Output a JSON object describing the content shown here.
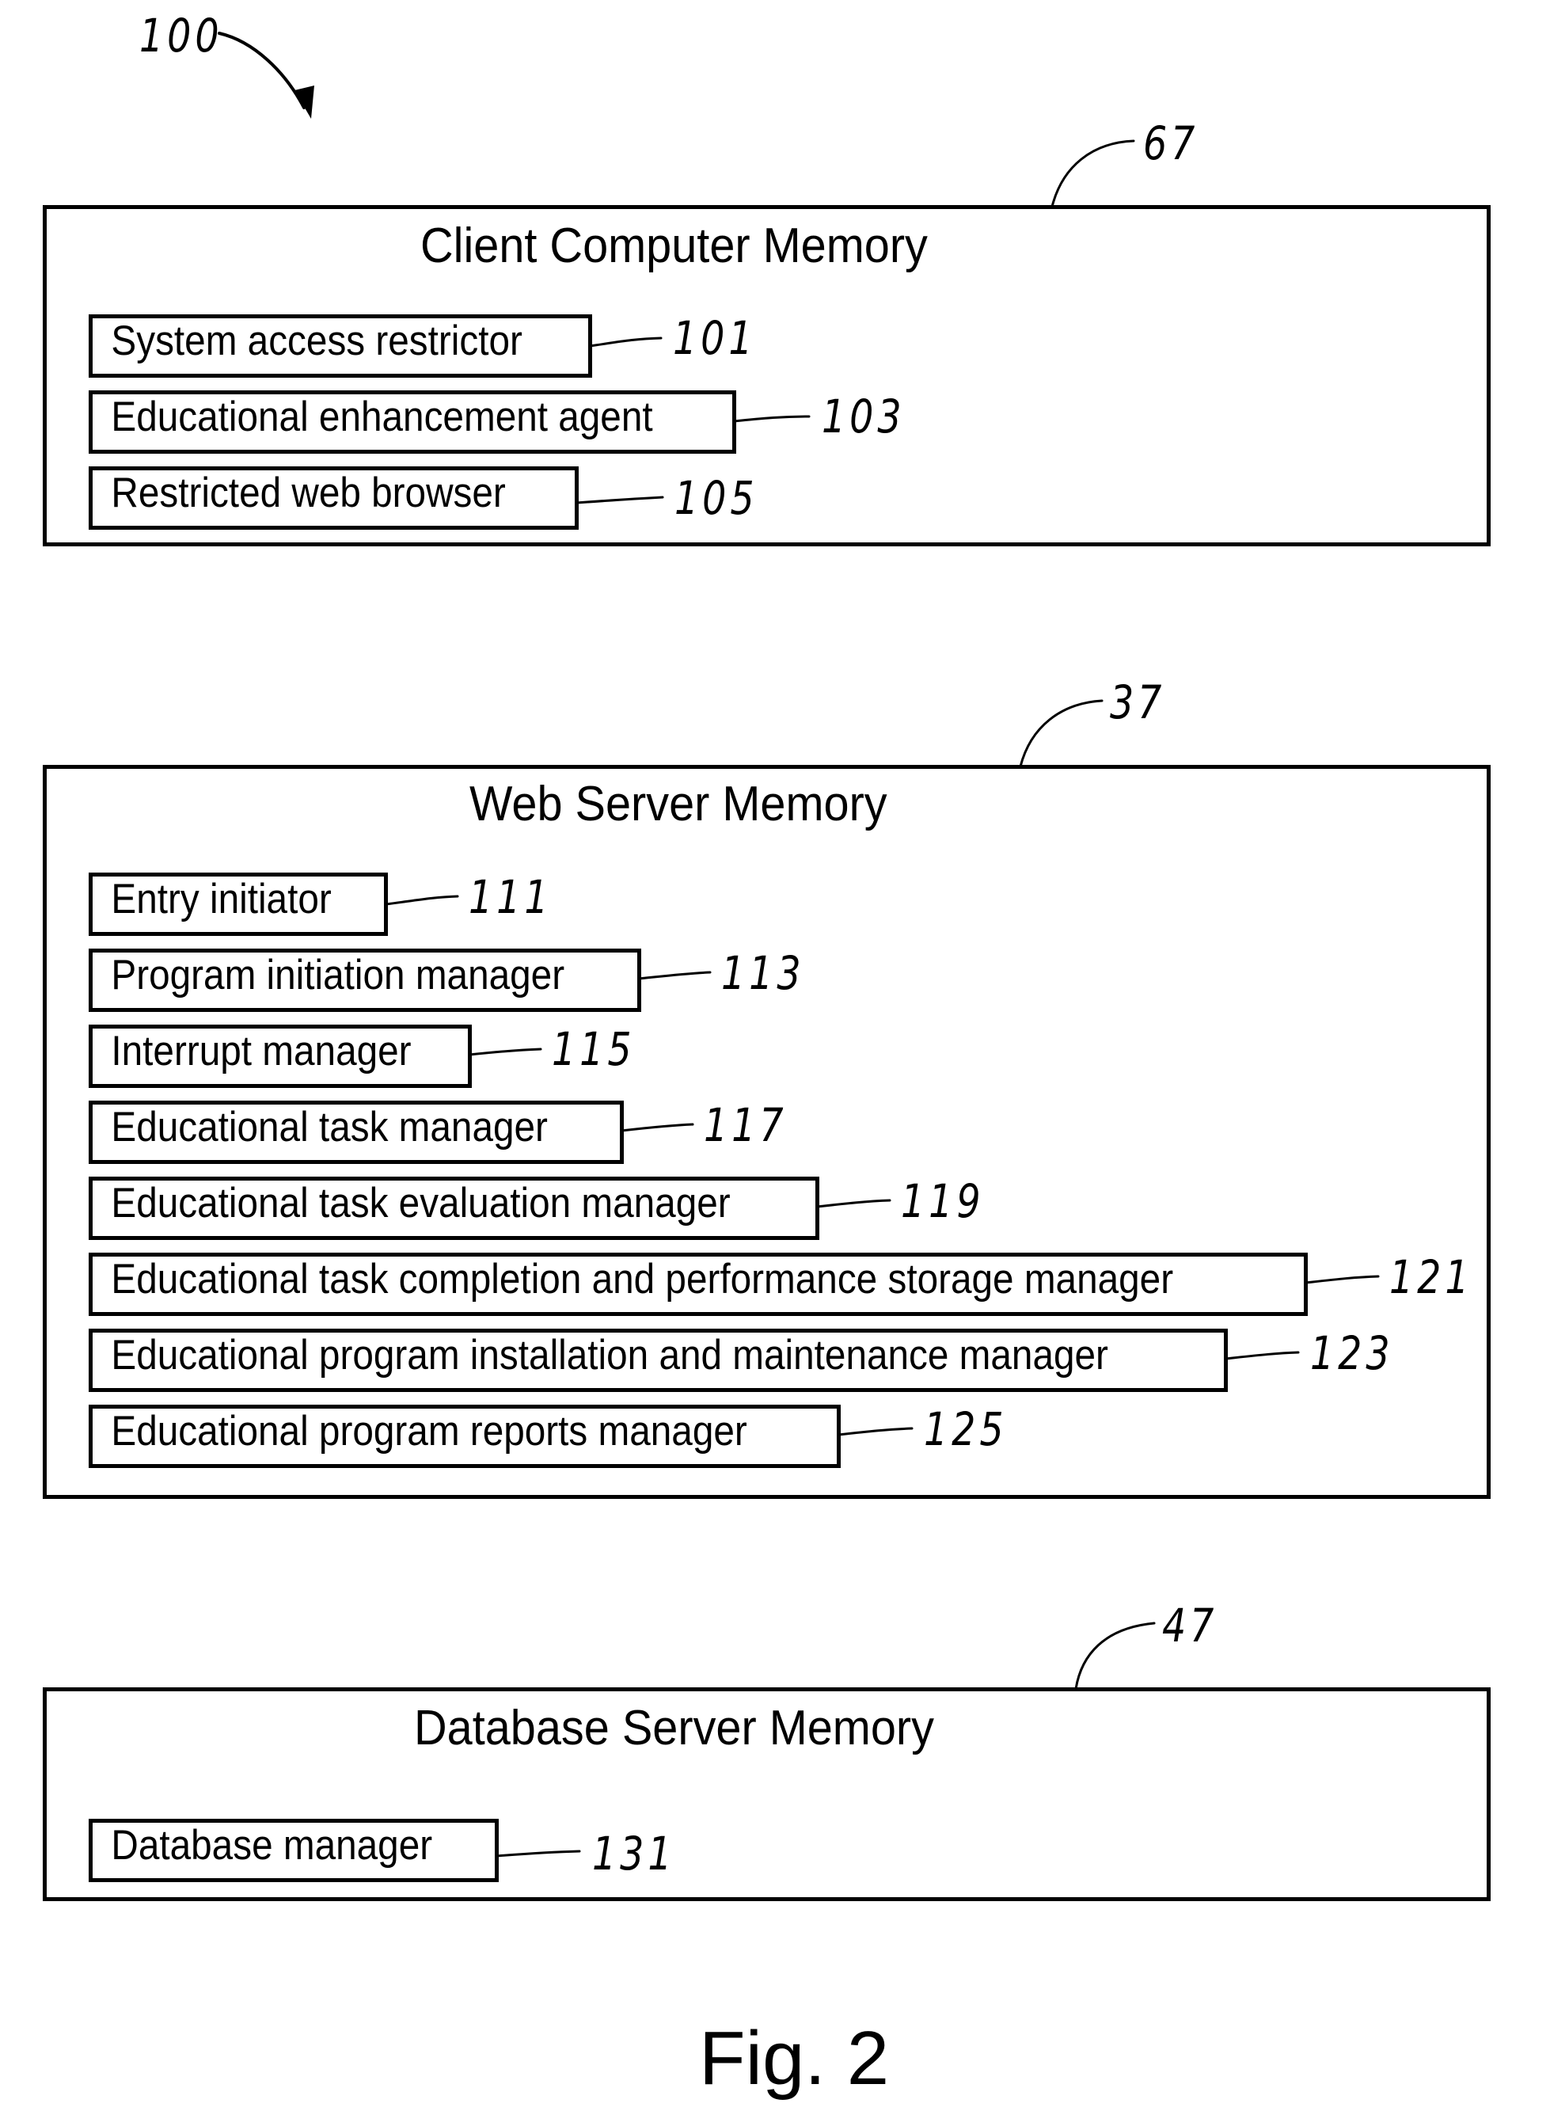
{
  "figure": {
    "reference": "100",
    "caption": "Fig. 2"
  },
  "blocks": [
    {
      "id": "client",
      "title": "Client Computer Memory",
      "reference": "67",
      "items": [
        {
          "label": "System access restrictor",
          "reference": "101"
        },
        {
          "label": "Educational enhancement agent",
          "reference": "103"
        },
        {
          "label": "Restricted web browser",
          "reference": "105"
        }
      ]
    },
    {
      "id": "web",
      "title": "Web Server Memory",
      "reference": "37",
      "items": [
        {
          "label": "Entry initiator",
          "reference": "111"
        },
        {
          "label": "Program initiation manager",
          "reference": "113"
        },
        {
          "label": "Interrupt manager",
          "reference": "115"
        },
        {
          "label": "Educational task manager",
          "reference": "117"
        },
        {
          "label": "Educational task evaluation manager",
          "reference": "119"
        },
        {
          "label": "Educational task completion and performance storage manager",
          "reference": "121"
        },
        {
          "label": "Educational program installation and maintenance manager",
          "reference": "123"
        },
        {
          "label": "Educational program reports manager",
          "reference": "125"
        }
      ]
    },
    {
      "id": "database",
      "title": "Database Server Memory",
      "reference": "47",
      "items": [
        {
          "label": "Database manager",
          "reference": "131"
        }
      ]
    }
  ]
}
